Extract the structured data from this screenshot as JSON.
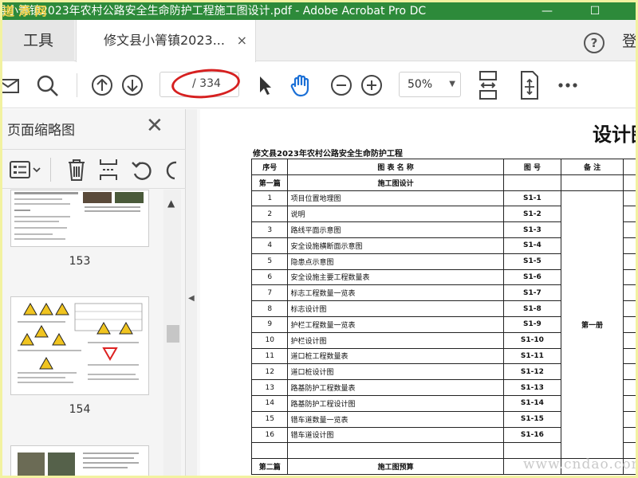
{
  "titlebar": {
    "title": "县小箐镇2023年农村公路安全生命防护工程施工图设计.pdf - Adobe Acrobat Pro DC",
    "watermark": "道 添 网",
    "minimize": "—",
    "maximize": "☐"
  },
  "tabs": {
    "tools": "工具",
    "document": "修文县小箐镇2023...",
    "close": "×",
    "help": "?",
    "login": "登"
  },
  "toolbar": {
    "page_current": "",
    "page_total": "/ 334",
    "zoom": "50%"
  },
  "panel": {
    "title": "页面缩略图",
    "thumbnails": [
      {
        "page": "153"
      },
      {
        "page": "154"
      }
    ]
  },
  "document": {
    "heading": "设计图",
    "project": "修文县2023年农村公路安全生命防护工程",
    "table": {
      "headers": [
        "序号",
        "图 表 名 称",
        "图 号",
        "备 注"
      ],
      "section1": {
        "label": "第一篇",
        "title": "施工图设计",
        "note": "第一册"
      },
      "rows": [
        {
          "no": "1",
          "name": "项目位置地理图",
          "code": "S1-1"
        },
        {
          "no": "2",
          "name": "说明",
          "code": "S1-2"
        },
        {
          "no": "3",
          "name": "路线平面示意图",
          "code": "S1-3"
        },
        {
          "no": "4",
          "name": "安全设施横断面示意图",
          "code": "S1-4"
        },
        {
          "no": "5",
          "name": "隐患点示意图",
          "code": "S1-5"
        },
        {
          "no": "6",
          "name": "安全设施主要工程数量表",
          "code": "S1-6"
        },
        {
          "no": "7",
          "name": "标志工程数量一览表",
          "code": "S1-7"
        },
        {
          "no": "8",
          "name": "标志设计图",
          "code": "S1-8"
        },
        {
          "no": "9",
          "name": "护栏工程数量一览表",
          "code": "S1-9"
        },
        {
          "no": "10",
          "name": "护栏设计图",
          "code": "S1-10"
        },
        {
          "no": "11",
          "name": "道口桩工程数量表",
          "code": "S1-11"
        },
        {
          "no": "12",
          "name": "道口桩设计图",
          "code": "S1-12"
        },
        {
          "no": "13",
          "name": "路基防护工程数量表",
          "code": "S1-13"
        },
        {
          "no": "14",
          "name": "路基防护工程设计图",
          "code": "S1-14"
        },
        {
          "no": "15",
          "name": "错车道数量一览表",
          "code": "S1-15"
        },
        {
          "no": "16",
          "name": "错车道设计图",
          "code": "S1-16"
        }
      ],
      "section2": {
        "label": "第二篇",
        "title": "施工图预算"
      }
    },
    "watermark": "www.cndao.com"
  }
}
